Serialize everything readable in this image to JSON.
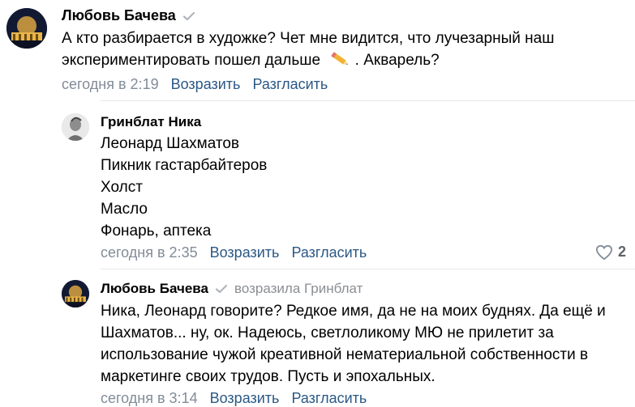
{
  "comments": [
    {
      "author": "Любовь Бачева",
      "lines": [
        "А кто разбирается в художке? Чет мне видится, что лучезарный наш",
        "экспериментировать пошел дальше",
        ". Акварель?"
      ],
      "time": "сегодня в 2:19",
      "reply": "Возразить",
      "disagree": "Разгласить"
    },
    {
      "author": "Гринблат Ника",
      "lines": [
        "Леонард Шахматов",
        "Пикник гастарбайтеров",
        "Холст",
        "Масло",
        "Фонарь, аптека"
      ],
      "time": "сегодня в 2:35",
      "reply": "Возразить",
      "disagree": "Разгласить",
      "likes": "2"
    },
    {
      "author": "Любовь Бачева",
      "reply_to": "возразила Гринблат",
      "lines": [
        "Ника, Леонард говорите? Редкое имя, да не на моих буднях. Да ещё и",
        "Шахматов... ну, ок. Надеюсь, светлоликому МЮ не прилетит за",
        "использование чужой креативной нематериальной собственности в",
        "маркетинге своих трудов. Пусть и эпохальных."
      ],
      "time": "сегодня в 3:14",
      "reply": "Возразить",
      "disagree": "Разгласить"
    }
  ],
  "colors": {
    "link": "#2a5885",
    "meta": "#818c99",
    "divider": "#e7e8ec"
  }
}
